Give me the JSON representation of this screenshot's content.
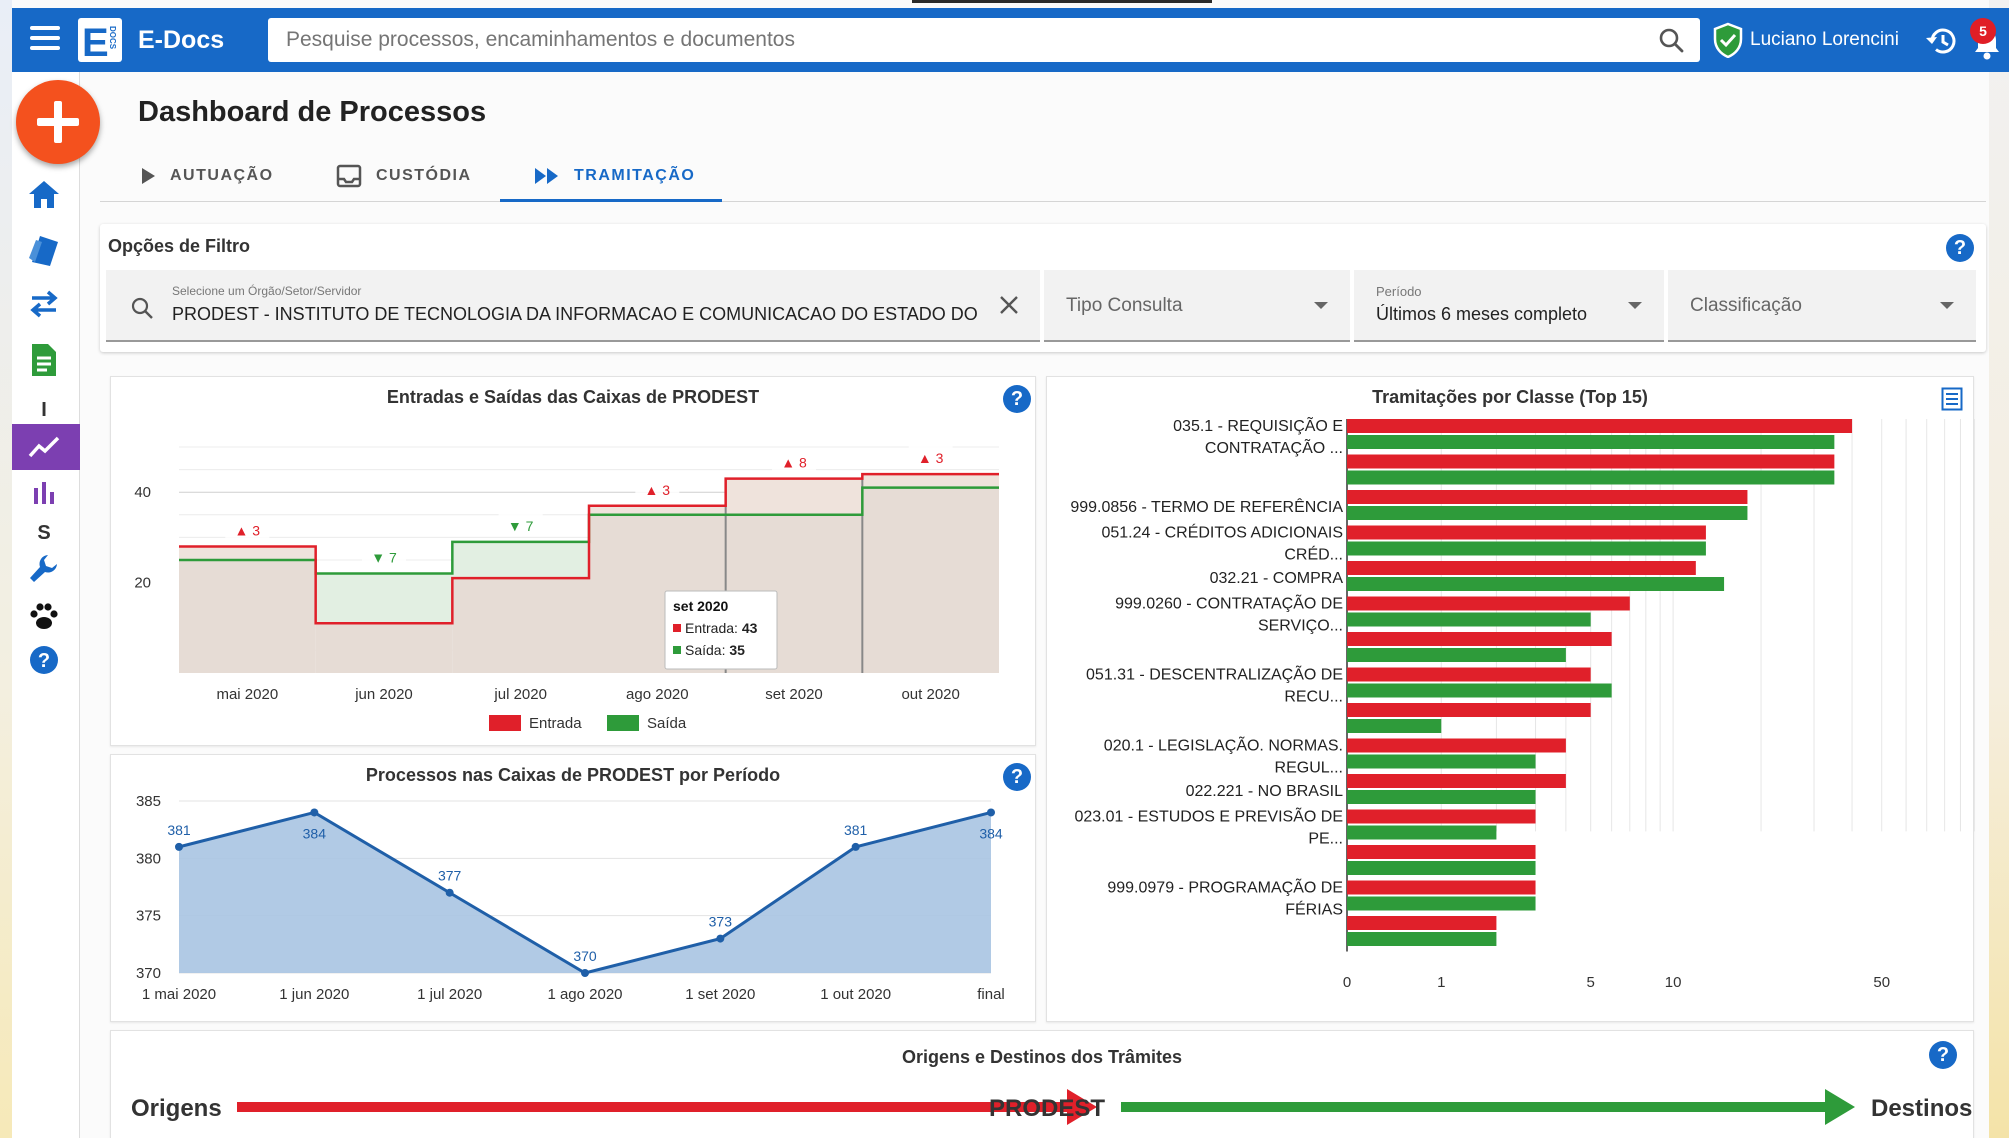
{
  "app": {
    "name": "E-Docs",
    "logo_letter": "E",
    "logo_small": "DOCS"
  },
  "search": {
    "placeholder": "Pesquise processos, encaminhamentos e documentos"
  },
  "user": {
    "name": "Luciano Lorencini",
    "notifications": "5"
  },
  "sidebar": {
    "letters": [
      "I",
      "S"
    ]
  },
  "page": {
    "title": "Dashboard de Processos"
  },
  "tabs": [
    {
      "label": "AUTUAÇÃO"
    },
    {
      "label": "CUSTÓDIA"
    },
    {
      "label": "TRAMITAÇÃO"
    }
  ],
  "filters": {
    "title": "Opções de Filtro",
    "orgao_label": "Selecione um Órgão/Setor/Servidor",
    "orgao_value": "PRODEST - INSTITUTO DE TECNOLOGIA DA INFORMACAO E COMUNICACAO DO ESTADO DO ES",
    "tipo_placeholder": "Tipo Consulta",
    "periodo_label": "Período",
    "periodo_value": "Últimos 6 meses completo",
    "classificacao_placeholder": "Classificação"
  },
  "colors": {
    "entrada": "#e0202a",
    "saida": "#2e9b3a",
    "primary": "#1769c7",
    "area": "#a9c4e2"
  },
  "chart_data": [
    {
      "type": "line",
      "title": "Entradas e Saídas das Caixas de PRODEST",
      "categories": [
        "mai 2020",
        "jun 2020",
        "jul 2020",
        "ago 2020",
        "set 2020",
        "out 2020"
      ],
      "series": [
        {
          "name": "Entrada",
          "values": [
            28,
            11,
            21,
            37,
            43,
            44
          ]
        },
        {
          "name": "Saída",
          "values": [
            25,
            22,
            29,
            35,
            35,
            41
          ]
        }
      ],
      "annotations": [
        "▲ 3",
        "▼ 7",
        "▼ 7",
        "▲ 3",
        "▲ 8",
        "▲ 3"
      ],
      "y_ticks": [
        "20",
        "40"
      ],
      "ylim": [
        0,
        50
      ],
      "legend": [
        "Entrada",
        "Saída"
      ],
      "tooltip": {
        "title": "set 2020",
        "lines": [
          {
            "label": "Entrada",
            "value": "43"
          },
          {
            "label": "Saída",
            "value": "35"
          }
        ]
      }
    },
    {
      "type": "area",
      "title": "Processos nas Caixas de PRODEST por Período",
      "categories": [
        "1 mai 2020",
        "1 jun 2020",
        "1 jul 2020",
        "1 ago 2020",
        "1 set 2020",
        "1 out 2020",
        "final"
      ],
      "values": [
        381,
        384,
        377,
        370,
        373,
        381,
        384
      ],
      "y_ticks": [
        "370",
        "375",
        "380",
        "385"
      ],
      "ylim": [
        370,
        385
      ]
    },
    {
      "type": "bar",
      "orientation": "horizontal",
      "title": "Tramitações por Classe (Top 15)",
      "x_scale": "log",
      "x_ticks": [
        "0",
        "1",
        "5",
        "10",
        "50"
      ],
      "categories": [
        [
          "035.1 - REQUISIÇÃO E",
          "CONTRATAÇÃO ..."
        ],
        [
          ""
        ],
        [
          "999.0856 - TERMO DE REFERÊNCIA"
        ],
        [
          "051.24 - CRÉDITOS ADICIONAIS",
          "CRÉD..."
        ],
        [
          "032.21 - COMPRA"
        ],
        [
          "999.0260 - CONTRATAÇÃO DE",
          "SERVIÇO..."
        ],
        [
          ""
        ],
        [
          "051.31 - DESCENTRALIZAÇÃO DE",
          "RECU..."
        ],
        [
          ""
        ],
        [
          "020.1 - LEGISLAÇÃO. NORMAS.",
          "REGUL..."
        ],
        [
          "022.221 - NO BRASIL"
        ],
        [
          "023.01 - ESTUDOS E PREVISÃO DE",
          "PE..."
        ],
        [
          ""
        ],
        [
          "999.0979 - PROGRAMAÇÃO DE",
          "FÉRIAS"
        ],
        [
          ""
        ]
      ],
      "series": [
        {
          "name": "Entrada",
          "values": [
            40,
            35,
            18,
            13,
            12,
            7,
            6,
            5,
            5,
            4,
            4,
            3,
            3,
            3,
            2
          ]
        },
        {
          "name": "Saída",
          "values": [
            35,
            35,
            18,
            13,
            15,
            5,
            4,
            6,
            1,
            3,
            3,
            2,
            3,
            3,
            2
          ]
        }
      ]
    }
  ],
  "flow": {
    "title": "Origens e Destinos dos Trâmites",
    "origens": "Origens",
    "center": "PRODEST",
    "destinos": "Destinos"
  }
}
